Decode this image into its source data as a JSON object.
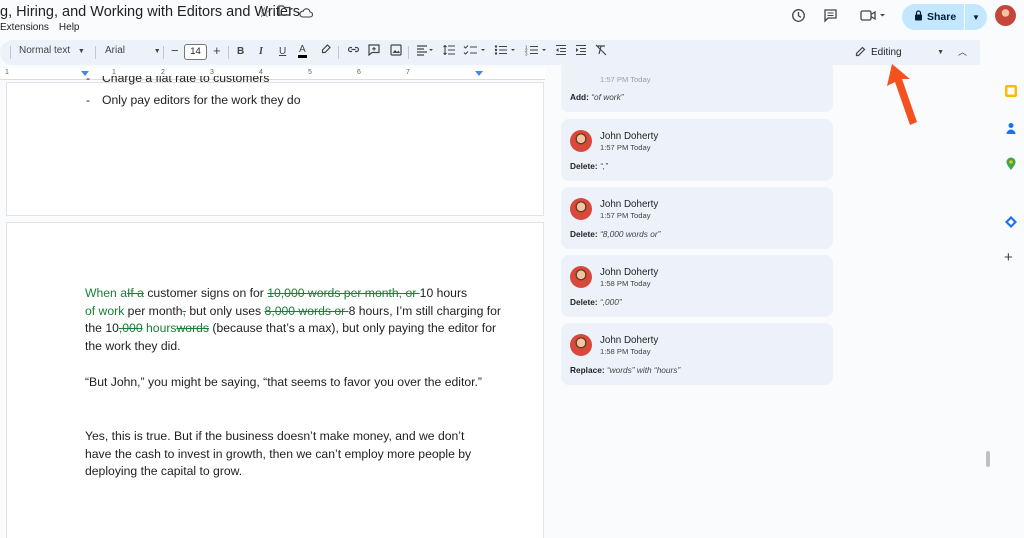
{
  "document": {
    "title": "g, Hiring, and Working with Editors and Writers",
    "menu": [
      "Extensions",
      "Help"
    ]
  },
  "header": {
    "share_label": "Share"
  },
  "toolbar": {
    "style_label": "Normal text",
    "font_label": "Arial",
    "font_size": "14",
    "mode_label": "Editing"
  },
  "ruler": {
    "numbers": [
      "1",
      "1",
      "2",
      "3",
      "4",
      "5",
      "6",
      "7"
    ]
  },
  "page1": {
    "bullets": [
      "Charge a flat rate to customers",
      "Only pay editors for the work they do"
    ]
  },
  "page2": {
    "p1": {
      "s1": "When a",
      "d1": "If a",
      "t1": " customer signs on for ",
      "d2": "10,000 words per month, or ",
      "t2": "10 hours",
      "s2": "of work",
      "t3": " per month",
      "d3": ",",
      "t4": " but only uses ",
      "d4": "8,000 words or ",
      "t5": "8 hours, I’m still charging for the 10",
      "d5": ",000",
      "s3": " hours",
      "d6": "words",
      "t6": " (because that’s a max), but only paying the editor for the work they did."
    },
    "p2": "“But John,” you might be saying, “that seems to favor you over the editor.”",
    "p3": "Yes, this is true. But if the business doesn’t make money, and we don’t have the cash to invest in growth, then we can’t employ more people by deploying the capital to grow."
  },
  "suggestions": [
    {
      "name": "",
      "time": "1:57 PM Today",
      "action": "Add:",
      "detail": "“of work”"
    },
    {
      "name": "John Doherty",
      "time": "1:57 PM Today",
      "action": "Delete:",
      "detail": "“,”"
    },
    {
      "name": "John Doherty",
      "time": "1:57 PM Today",
      "action": "Delete:",
      "detail": "“8,000 words or”"
    },
    {
      "name": "John Doherty",
      "time": "1:58 PM Today",
      "action": "Delete:",
      "detail": "“,000”"
    },
    {
      "name": "John Doherty",
      "time": "1:58 PM Today",
      "action": "Replace:",
      "detail": "“words” with “hours”"
    }
  ],
  "colors": {
    "accent": "#c2e7ff",
    "suggestion_green": "#188038",
    "annotation_arrow": "#f4511e"
  }
}
